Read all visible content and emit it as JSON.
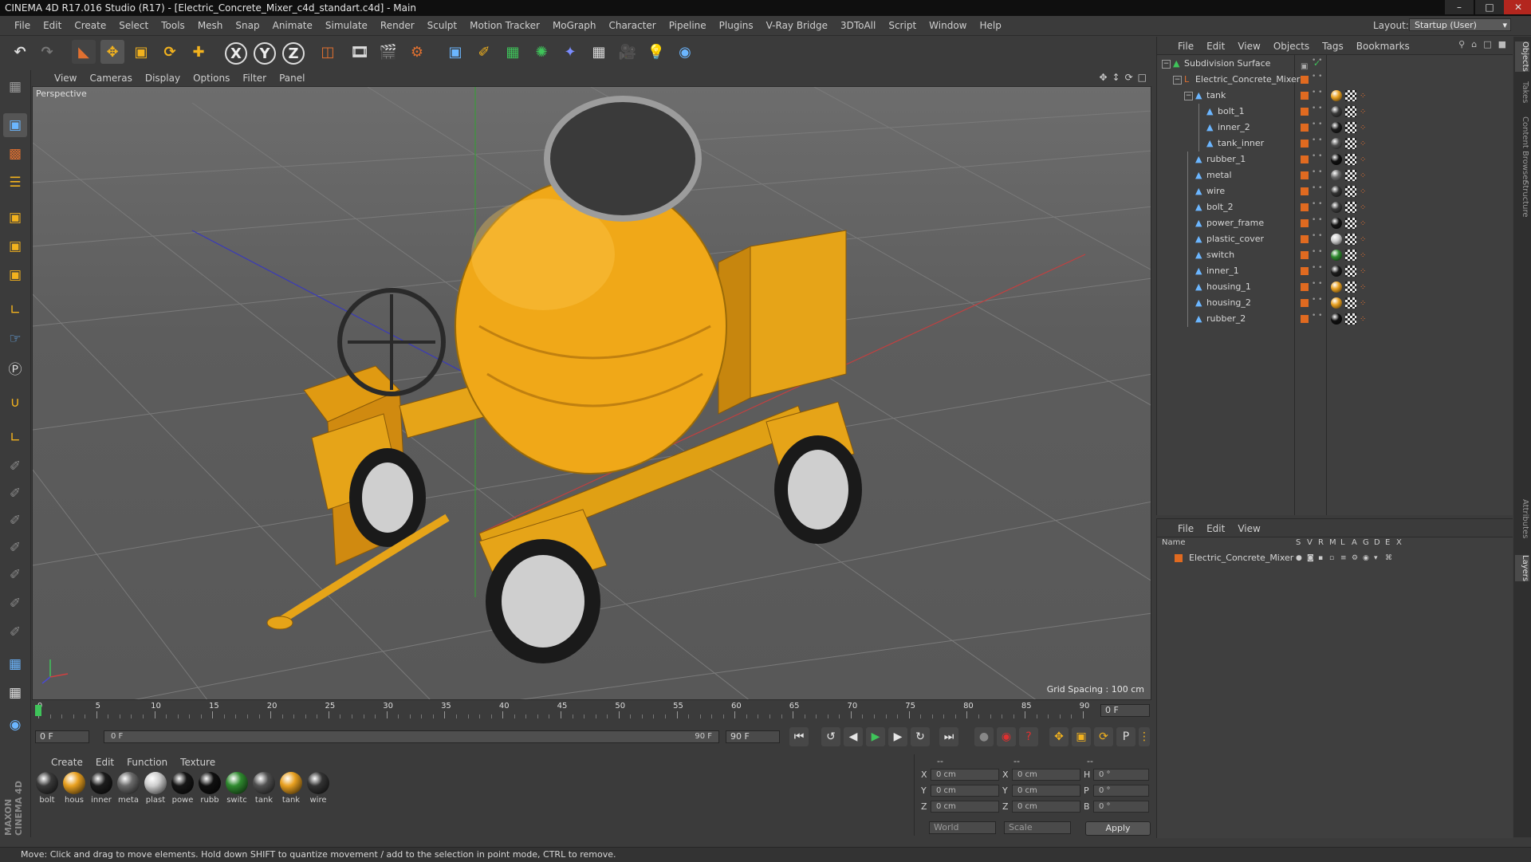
{
  "window": {
    "title": "CINEMA 4D R17.016 Studio (R17) - [Electric_Concrete_Mixer_c4d_standart.c4d] - Main",
    "controls": [
      "minimize",
      "maximize",
      "close"
    ]
  },
  "menubar": {
    "items": [
      "File",
      "Edit",
      "Create",
      "Select",
      "Tools",
      "Mesh",
      "Snap",
      "Animate",
      "Simulate",
      "Render",
      "Sculpt",
      "Motion Tracker",
      "MoGraph",
      "Character",
      "Pipeline",
      "Plugins",
      "V-Ray Bridge",
      "3DToAll",
      "Script",
      "Window",
      "Help"
    ],
    "layout_label": "Layout:",
    "layout_value": "Startup (User)"
  },
  "toolbar": {
    "axis_x": "X",
    "axis_y": "Y",
    "axis_z": "Z"
  },
  "viewport": {
    "menu": [
      "View",
      "Cameras",
      "Display",
      "Options",
      "Filter",
      "Panel"
    ],
    "label": "Perspective",
    "grid_spacing": "Grid Spacing : 100 cm"
  },
  "timeline": {
    "ticks": [
      "0",
      "5",
      "10",
      "15",
      "20",
      "25",
      "30",
      "35",
      "40",
      "45",
      "50",
      "55",
      "60",
      "65",
      "70",
      "75",
      "80",
      "85",
      "90"
    ],
    "current_frame": "0 F",
    "start_field": "0 F",
    "range_start": "0 F",
    "range_end": "90 F",
    "end_field": "90 F"
  },
  "materials": {
    "menu": [
      "Create",
      "Edit",
      "Function",
      "Texture"
    ],
    "items": [
      {
        "name": "bolt",
        "color": "#3a3a3a"
      },
      {
        "name": "hous",
        "color": "#e8a020"
      },
      {
        "name": "inner",
        "color": "#1c1c1c"
      },
      {
        "name": "meta",
        "color": "#6a6a6a"
      },
      {
        "name": "plast",
        "color": "#cfcfcf"
      },
      {
        "name": "powe",
        "color": "#161616"
      },
      {
        "name": "rubb",
        "color": "#101010"
      },
      {
        "name": "switc",
        "color": "#2f8a2f"
      },
      {
        "name": "tank",
        "color": "#505050"
      },
      {
        "name": "tank",
        "color": "#e8a020"
      },
      {
        "name": "wire",
        "color": "#333333"
      }
    ]
  },
  "coordinates": {
    "header": [
      "--",
      "--",
      "--"
    ],
    "rows": [
      {
        "a": "X",
        "av": "0 cm",
        "b": "X",
        "bv": "0 cm",
        "c": "H",
        "cv": "0 °"
      },
      {
        "a": "Y",
        "av": "0 cm",
        "b": "Y",
        "bv": "0 cm",
        "c": "P",
        "cv": "0 °"
      },
      {
        "a": "Z",
        "av": "0 cm",
        "b": "Z",
        "bv": "0 cm",
        "c": "B",
        "cv": "0 °"
      }
    ],
    "mode1": "World",
    "mode2": "Scale",
    "apply": "Apply"
  },
  "objects": {
    "menu": [
      "File",
      "Edit",
      "View",
      "Objects",
      "Tags",
      "Bookmarks"
    ],
    "tree": [
      {
        "name": "Subdivision Surface",
        "depth": 0,
        "kind": "subdiv"
      },
      {
        "name": "Electric_Concrete_Mixer",
        "depth": 1,
        "kind": "null"
      },
      {
        "name": "tank",
        "depth": 2,
        "kind": "poly",
        "tag": "#e8a020"
      },
      {
        "name": "bolt_1",
        "depth": 3,
        "kind": "poly",
        "tag": "#3a3a3a"
      },
      {
        "name": "inner_2",
        "depth": 3,
        "kind": "poly",
        "tag": "#1c1c1c"
      },
      {
        "name": "tank_inner",
        "depth": 3,
        "kind": "poly",
        "tag": "#505050"
      },
      {
        "name": "rubber_1",
        "depth": 2,
        "kind": "poly",
        "tag": "#101010"
      },
      {
        "name": "metal",
        "depth": 2,
        "kind": "poly",
        "tag": "#6a6a6a"
      },
      {
        "name": "wire",
        "depth": 2,
        "kind": "poly",
        "tag": "#333333"
      },
      {
        "name": "bolt_2",
        "depth": 2,
        "kind": "poly",
        "tag": "#3a3a3a"
      },
      {
        "name": "power_frame",
        "depth": 2,
        "kind": "poly",
        "tag": "#161616"
      },
      {
        "name": "plastic_cover",
        "depth": 2,
        "kind": "poly",
        "tag": "#cfcfcf"
      },
      {
        "name": "switch",
        "depth": 2,
        "kind": "poly",
        "tag": "#2f8a2f"
      },
      {
        "name": "inner_1",
        "depth": 2,
        "kind": "poly",
        "tag": "#1c1c1c"
      },
      {
        "name": "housing_1",
        "depth": 2,
        "kind": "poly",
        "tag": "#e8a020"
      },
      {
        "name": "housing_2",
        "depth": 2,
        "kind": "poly",
        "tag": "#e8a020"
      },
      {
        "name": "rubber_2",
        "depth": 2,
        "kind": "poly",
        "tag": "#101010"
      }
    ]
  },
  "layers": {
    "menu": [
      "File",
      "Edit",
      "View"
    ],
    "columns": [
      "Name",
      "S",
      "V",
      "R",
      "M",
      "L",
      "A",
      "G",
      "D",
      "E",
      "X"
    ],
    "rows": [
      {
        "name": "Electric_Concrete_Mixer",
        "color": "#e06a20"
      }
    ]
  },
  "sidetabs": [
    "Objects",
    "Takes",
    "Content Browser",
    "Structure",
    "Attributes",
    "Layers"
  ],
  "status": "Move: Click and drag to move elements. Hold down SHIFT to quantize movement / add to the selection in point mode, CTRL to remove.",
  "brand": "MAXON CINEMA 4D"
}
